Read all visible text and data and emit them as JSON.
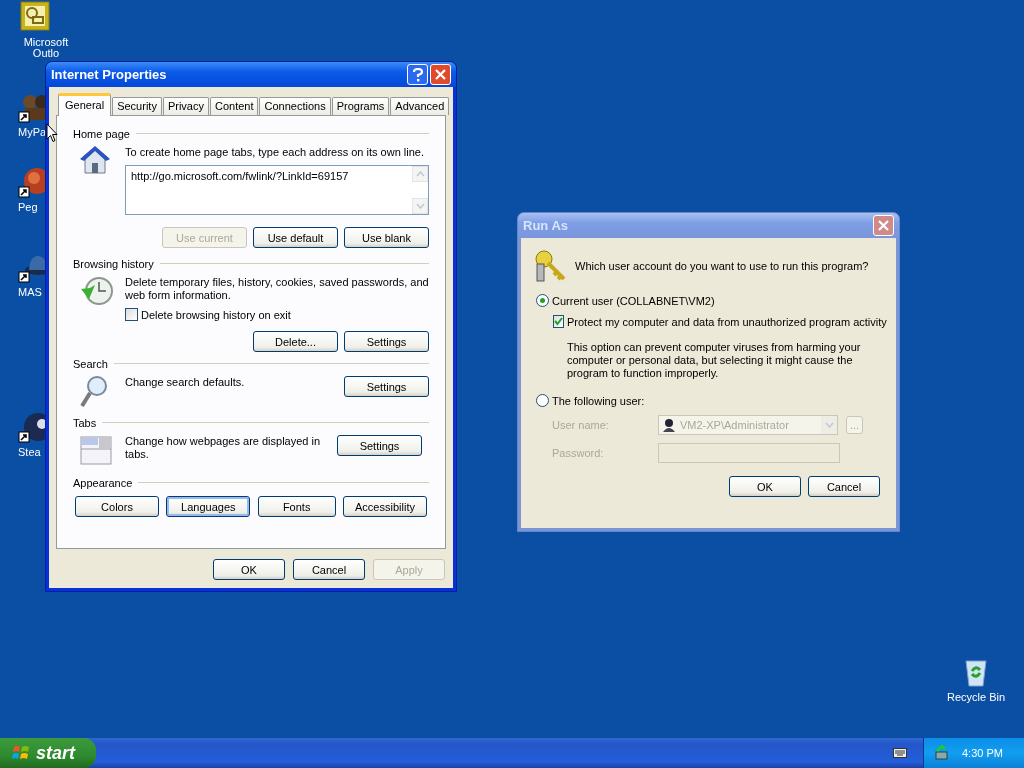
{
  "desktop_icons": [
    {
      "kind": "calendar",
      "label": "Microsoft Outlo",
      "shortcut": false
    },
    {
      "kind": "figures",
      "label": "MyPa",
      "shortcut": true
    },
    {
      "kind": "ball",
      "label": "Peg",
      "shortcut": true
    },
    {
      "kind": "hat",
      "label": "MAS",
      "shortcut": true
    },
    {
      "kind": "disc",
      "label": "Stea",
      "shortcut": true
    },
    {
      "kind": "recycle",
      "label": "Recycle Bin",
      "shortcut": false
    }
  ],
  "internet_properties": {
    "title": "Internet Properties",
    "active": true,
    "tabs": [
      {
        "label": "General",
        "selected": true
      },
      {
        "label": "Security",
        "selected": false
      },
      {
        "label": "Privacy",
        "selected": false
      },
      {
        "label": "Content",
        "selected": false
      },
      {
        "label": "Connections",
        "selected": false
      },
      {
        "label": "Programs",
        "selected": false
      },
      {
        "label": "Advanced",
        "selected": false
      }
    ],
    "sections": [
      {
        "kind": "home",
        "heading": "Home page",
        "description": "To create home page tabs, type each address on its own line.",
        "url": "http://go.microsoft.com/fwlink/?LinkId=69157",
        "buttons": [
          {
            "label": "Use current",
            "disabled": true
          },
          {
            "label": "Use default",
            "disabled": false
          },
          {
            "label": "Use blank",
            "disabled": false
          }
        ]
      },
      {
        "kind": "history",
        "heading": "Browsing history",
        "description": "Delete temporary files, history, cookies, saved passwords, and web form information.",
        "checkbox": {
          "label": "Delete browsing history on exit",
          "checked": false
        },
        "buttons": [
          {
            "label": "Delete...",
            "disabled": false
          },
          {
            "label": "Settings",
            "disabled": false
          }
        ]
      },
      {
        "kind": "search",
        "heading": "Search",
        "description": "Change search defaults.",
        "buttons": [
          {
            "label": "Settings",
            "disabled": false
          }
        ]
      },
      {
        "kind": "tabs",
        "heading": "Tabs",
        "description": "Change how webpages are displayed in tabs.",
        "buttons": [
          {
            "label": "Settings",
            "disabled": false
          }
        ]
      },
      {
        "kind": "appearance",
        "heading": "Appearance",
        "buttons": [
          {
            "label": "Colors",
            "focused": false
          },
          {
            "label": "Languages",
            "focused": true
          },
          {
            "label": "Fonts",
            "focused": false
          },
          {
            "label": "Accessibility",
            "focused": false
          }
        ]
      }
    ],
    "footer_buttons": [
      {
        "label": "OK",
        "disabled": false
      },
      {
        "label": "Cancel",
        "disabled": false
      },
      {
        "label": "Apply",
        "disabled": true
      }
    ]
  },
  "run_as": {
    "title": "Run As",
    "active": false,
    "question": "Which user account do you want to use to run this program?",
    "options": [
      {
        "label": "Current user (COLLABNET\\VM2)",
        "selected": true
      },
      {
        "label": "The following user:",
        "selected": false
      }
    ],
    "protect": {
      "label": "Protect my computer and data from unauthorized program activity",
      "checked": true
    },
    "note": "This option can prevent computer viruses from harming your computer or personal data, but selecting it might cause the program to function improperly.",
    "user_name": {
      "label": "User name:",
      "value": "VM2-XP\\Administrator",
      "browse": "..."
    },
    "password": {
      "label": "Password:"
    },
    "buttons": [
      {
        "label": "OK"
      },
      {
        "label": "Cancel"
      }
    ]
  },
  "taskbar": {
    "start": "start",
    "clock": "4:30 PM"
  }
}
